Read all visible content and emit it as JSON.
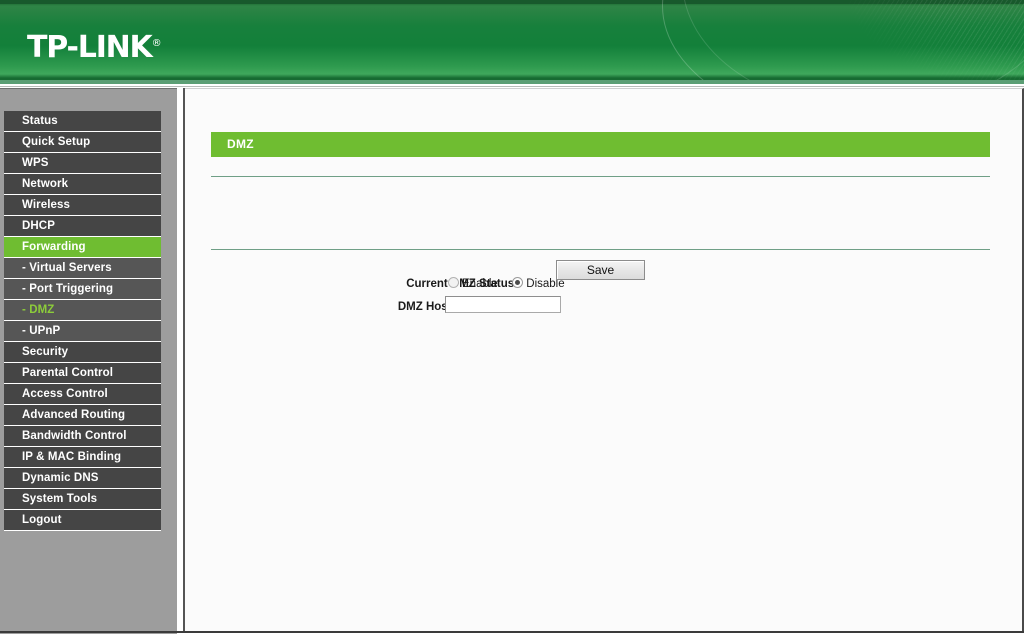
{
  "header": {
    "brand": "TP-LINK",
    "brand_registered_mark": "®",
    "brand_color": "#1a7c3c"
  },
  "sidebar": {
    "items": [
      {
        "label": "Status",
        "type": "main",
        "state": "normal"
      },
      {
        "label": "Quick Setup",
        "type": "main",
        "state": "normal"
      },
      {
        "label": "WPS",
        "type": "main",
        "state": "normal"
      },
      {
        "label": "Network",
        "type": "main",
        "state": "normal"
      },
      {
        "label": "Wireless",
        "type": "main",
        "state": "normal"
      },
      {
        "label": "DHCP",
        "type": "main",
        "state": "normal"
      },
      {
        "label": "Forwarding",
        "type": "main",
        "state": "active"
      },
      {
        "label": "- Virtual Servers",
        "type": "sub",
        "state": "normal"
      },
      {
        "label": "- Port Triggering",
        "type": "sub",
        "state": "normal"
      },
      {
        "label": "- DMZ",
        "type": "sub",
        "state": "current"
      },
      {
        "label": "- UPnP",
        "type": "sub",
        "state": "normal"
      },
      {
        "label": "Security",
        "type": "main",
        "state": "normal"
      },
      {
        "label": "Parental Control",
        "type": "main",
        "state": "normal"
      },
      {
        "label": "Access Control",
        "type": "main",
        "state": "normal"
      },
      {
        "label": "Advanced Routing",
        "type": "main",
        "state": "normal"
      },
      {
        "label": "Bandwidth Control",
        "type": "main",
        "state": "normal"
      },
      {
        "label": "IP & MAC Binding",
        "type": "main",
        "state": "normal"
      },
      {
        "label": "Dynamic DNS",
        "type": "main",
        "state": "normal"
      },
      {
        "label": "System Tools",
        "type": "main",
        "state": "normal"
      },
      {
        "label": "Logout",
        "type": "main",
        "state": "normal"
      }
    ],
    "active_color": "#6fbd31",
    "current_text_color": "#8ccc3a"
  },
  "main": {
    "page_title": "DMZ",
    "title_bar_color": "#6fbd31",
    "fields": {
      "dmz_status": {
        "label": "Current DMZ Status:",
        "options": [
          {
            "label": "Enable",
            "selected": false
          },
          {
            "label": "Disable",
            "selected": true
          }
        ],
        "selected_value": "Disable"
      },
      "dmz_host_ip": {
        "label": "DMZ Host IP Address:",
        "value": "",
        "placeholder": ""
      }
    },
    "save_button": "Save"
  }
}
